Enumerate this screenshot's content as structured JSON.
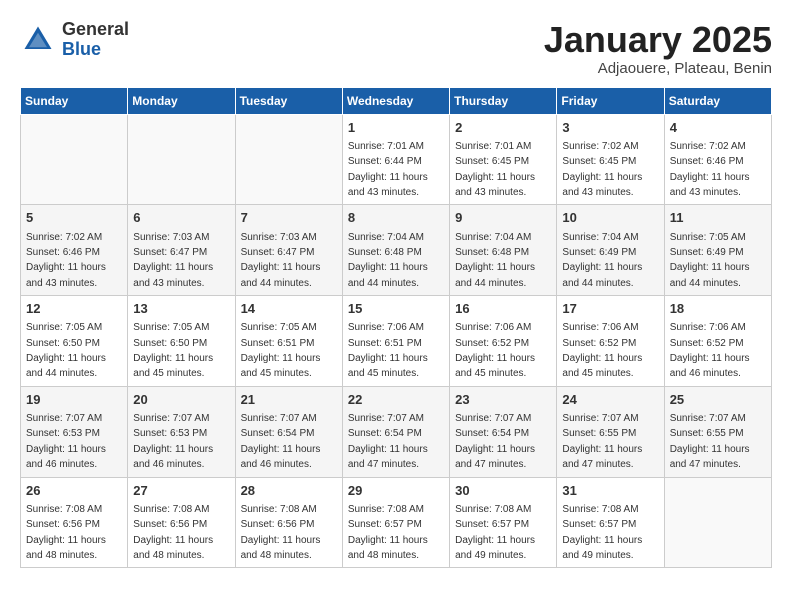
{
  "header": {
    "logo_general": "General",
    "logo_blue": "Blue",
    "title": "January 2025",
    "subtitle": "Adjaouere, Plateau, Benin"
  },
  "days_of_week": [
    "Sunday",
    "Monday",
    "Tuesday",
    "Wednesday",
    "Thursday",
    "Friday",
    "Saturday"
  ],
  "weeks": [
    [
      {
        "day": "",
        "info": ""
      },
      {
        "day": "",
        "info": ""
      },
      {
        "day": "",
        "info": ""
      },
      {
        "day": "1",
        "info": "Sunrise: 7:01 AM\nSunset: 6:44 PM\nDaylight: 11 hours\nand 43 minutes."
      },
      {
        "day": "2",
        "info": "Sunrise: 7:01 AM\nSunset: 6:45 PM\nDaylight: 11 hours\nand 43 minutes."
      },
      {
        "day": "3",
        "info": "Sunrise: 7:02 AM\nSunset: 6:45 PM\nDaylight: 11 hours\nand 43 minutes."
      },
      {
        "day": "4",
        "info": "Sunrise: 7:02 AM\nSunset: 6:46 PM\nDaylight: 11 hours\nand 43 minutes."
      }
    ],
    [
      {
        "day": "5",
        "info": "Sunrise: 7:02 AM\nSunset: 6:46 PM\nDaylight: 11 hours\nand 43 minutes."
      },
      {
        "day": "6",
        "info": "Sunrise: 7:03 AM\nSunset: 6:47 PM\nDaylight: 11 hours\nand 43 minutes."
      },
      {
        "day": "7",
        "info": "Sunrise: 7:03 AM\nSunset: 6:47 PM\nDaylight: 11 hours\nand 44 minutes."
      },
      {
        "day": "8",
        "info": "Sunrise: 7:04 AM\nSunset: 6:48 PM\nDaylight: 11 hours\nand 44 minutes."
      },
      {
        "day": "9",
        "info": "Sunrise: 7:04 AM\nSunset: 6:48 PM\nDaylight: 11 hours\nand 44 minutes."
      },
      {
        "day": "10",
        "info": "Sunrise: 7:04 AM\nSunset: 6:49 PM\nDaylight: 11 hours\nand 44 minutes."
      },
      {
        "day": "11",
        "info": "Sunrise: 7:05 AM\nSunset: 6:49 PM\nDaylight: 11 hours\nand 44 minutes."
      }
    ],
    [
      {
        "day": "12",
        "info": "Sunrise: 7:05 AM\nSunset: 6:50 PM\nDaylight: 11 hours\nand 44 minutes."
      },
      {
        "day": "13",
        "info": "Sunrise: 7:05 AM\nSunset: 6:50 PM\nDaylight: 11 hours\nand 45 minutes."
      },
      {
        "day": "14",
        "info": "Sunrise: 7:05 AM\nSunset: 6:51 PM\nDaylight: 11 hours\nand 45 minutes."
      },
      {
        "day": "15",
        "info": "Sunrise: 7:06 AM\nSunset: 6:51 PM\nDaylight: 11 hours\nand 45 minutes."
      },
      {
        "day": "16",
        "info": "Sunrise: 7:06 AM\nSunset: 6:52 PM\nDaylight: 11 hours\nand 45 minutes."
      },
      {
        "day": "17",
        "info": "Sunrise: 7:06 AM\nSunset: 6:52 PM\nDaylight: 11 hours\nand 45 minutes."
      },
      {
        "day": "18",
        "info": "Sunrise: 7:06 AM\nSunset: 6:52 PM\nDaylight: 11 hours\nand 46 minutes."
      }
    ],
    [
      {
        "day": "19",
        "info": "Sunrise: 7:07 AM\nSunset: 6:53 PM\nDaylight: 11 hours\nand 46 minutes."
      },
      {
        "day": "20",
        "info": "Sunrise: 7:07 AM\nSunset: 6:53 PM\nDaylight: 11 hours\nand 46 minutes."
      },
      {
        "day": "21",
        "info": "Sunrise: 7:07 AM\nSunset: 6:54 PM\nDaylight: 11 hours\nand 46 minutes."
      },
      {
        "day": "22",
        "info": "Sunrise: 7:07 AM\nSunset: 6:54 PM\nDaylight: 11 hours\nand 47 minutes."
      },
      {
        "day": "23",
        "info": "Sunrise: 7:07 AM\nSunset: 6:54 PM\nDaylight: 11 hours\nand 47 minutes."
      },
      {
        "day": "24",
        "info": "Sunrise: 7:07 AM\nSunset: 6:55 PM\nDaylight: 11 hours\nand 47 minutes."
      },
      {
        "day": "25",
        "info": "Sunrise: 7:07 AM\nSunset: 6:55 PM\nDaylight: 11 hours\nand 47 minutes."
      }
    ],
    [
      {
        "day": "26",
        "info": "Sunrise: 7:08 AM\nSunset: 6:56 PM\nDaylight: 11 hours\nand 48 minutes."
      },
      {
        "day": "27",
        "info": "Sunrise: 7:08 AM\nSunset: 6:56 PM\nDaylight: 11 hours\nand 48 minutes."
      },
      {
        "day": "28",
        "info": "Sunrise: 7:08 AM\nSunset: 6:56 PM\nDaylight: 11 hours\nand 48 minutes."
      },
      {
        "day": "29",
        "info": "Sunrise: 7:08 AM\nSunset: 6:57 PM\nDaylight: 11 hours\nand 48 minutes."
      },
      {
        "day": "30",
        "info": "Sunrise: 7:08 AM\nSunset: 6:57 PM\nDaylight: 11 hours\nand 49 minutes."
      },
      {
        "day": "31",
        "info": "Sunrise: 7:08 AM\nSunset: 6:57 PM\nDaylight: 11 hours\nand 49 minutes."
      },
      {
        "day": "",
        "info": ""
      }
    ]
  ]
}
